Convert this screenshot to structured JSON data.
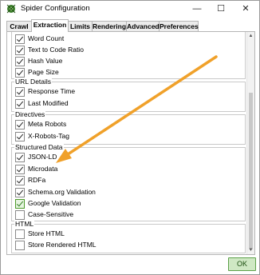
{
  "window": {
    "title": "Spider Configuration",
    "minimize_glyph": "—",
    "maximize_glyph": "☐",
    "close_glyph": "✕"
  },
  "tabs": [
    "Crawl",
    "Extraction",
    "Limits",
    "Rendering",
    "Advanced",
    "Preferences"
  ],
  "active_tab": "Extraction",
  "groups": {
    "top": {
      "items": [
        {
          "label": "Word Count",
          "checked": true
        },
        {
          "label": "Text to Code Ratio",
          "checked": true
        },
        {
          "label": "Hash Value",
          "checked": true
        },
        {
          "label": "Page Size",
          "checked": true
        }
      ]
    },
    "url_details": {
      "title": "URL Details",
      "items": [
        {
          "label": "Response Time",
          "checked": true
        },
        {
          "label": "Last Modified",
          "checked": true
        }
      ]
    },
    "directives": {
      "title": "Directives",
      "items": [
        {
          "label": "Meta Robots",
          "checked": true
        },
        {
          "label": "X-Robots-Tag",
          "checked": true
        }
      ]
    },
    "structured_data": {
      "title": "Structured Data",
      "items": [
        {
          "label": "JSON-LD",
          "checked": true
        },
        {
          "label": "Microdata",
          "checked": true
        },
        {
          "label": "RDFa",
          "checked": true
        },
        {
          "label": "Schema.org Validation",
          "checked": true
        },
        {
          "label": "Google Validation",
          "checked": true,
          "style": "green"
        },
        {
          "label": "Case-Sensitive",
          "checked": false
        }
      ]
    },
    "html": {
      "title": "HTML",
      "items": [
        {
          "label": "Store HTML",
          "checked": false
        },
        {
          "label": "Store Rendered HTML",
          "checked": false
        }
      ]
    }
  },
  "ok_label": "OK",
  "colors": {
    "arrow": "#f0a12a",
    "ok_bg": "#cfe8c4",
    "ok_border": "#5da14a",
    "google_check_border": "#4c9a2a"
  }
}
